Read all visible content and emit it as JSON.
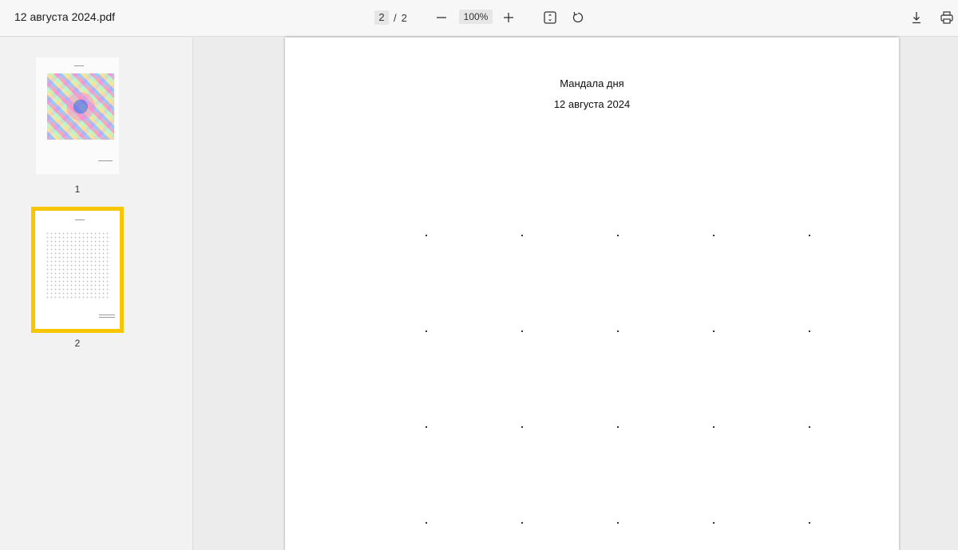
{
  "app": {
    "document_title": "12 августа 2024.pdf"
  },
  "toolbar": {
    "current_page": "2",
    "page_separator": "/",
    "total_pages": "2",
    "zoom": "100%",
    "icons": {
      "zoom_out": "minus-icon",
      "zoom_in": "plus-icon",
      "fit_page": "fit-page-icon",
      "rotate": "rotate-icon",
      "download": "download-icon",
      "print": "print-icon"
    }
  },
  "sidebar": {
    "thumbnails": [
      {
        "label": "1",
        "selected": false
      },
      {
        "label": "2",
        "selected": true
      }
    ],
    "selection_color": "#f7c600"
  },
  "page": {
    "heading": "Мандала дня",
    "date": "12 августа 2024"
  }
}
